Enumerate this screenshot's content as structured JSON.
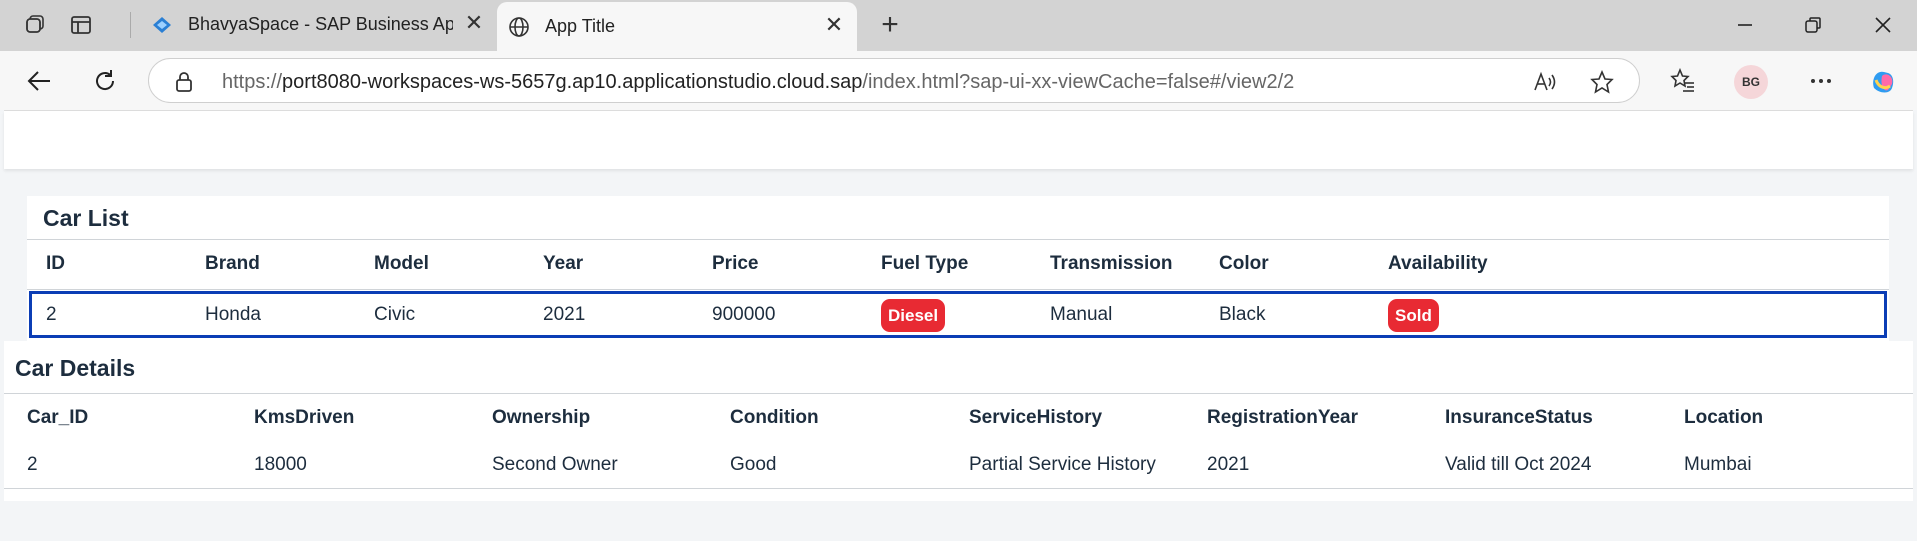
{
  "browser": {
    "tabs": [
      {
        "title": "BhavyaSpace - SAP Business Appl",
        "active": false
      },
      {
        "title": "App Title",
        "active": true
      }
    ],
    "url": {
      "scheme": "https://",
      "host": "port8080-workspaces-ws-5657g.ap10.applicationstudio.cloud.sap",
      "path": "/index.html?sap-ui-xx-viewCache=false#/view2/2"
    },
    "avatar_initials": "BG"
  },
  "car_list": {
    "title": "Car List",
    "columns": [
      "ID",
      "Brand",
      "Model",
      "Year",
      "Price",
      "Fuel Type",
      "Transmission",
      "Color",
      "Availability"
    ],
    "row": {
      "id": "2",
      "brand": "Honda",
      "model": "Civic",
      "year": "2021",
      "price": "900000",
      "fuel_type": "Diesel",
      "transmission": "Manual",
      "color": "Black",
      "availability": "Sold"
    }
  },
  "car_details": {
    "title": "Car Details",
    "columns": [
      "Car_ID",
      "KmsDriven",
      "Ownership",
      "Condition",
      "ServiceHistory",
      "RegistrationYear",
      "InsuranceStatus",
      "Location"
    ],
    "row": {
      "car_id": "2",
      "kms_driven": "18000",
      "ownership": "Second Owner",
      "condition": "Good",
      "service_history": "Partial Service History",
      "registration_year": "2021",
      "insurance_status": "Valid till Oct 2024",
      "location": "Mumbai"
    }
  },
  "colors": {
    "badge_red": "#e82a33",
    "selected_row_border": "#0b3db5"
  }
}
